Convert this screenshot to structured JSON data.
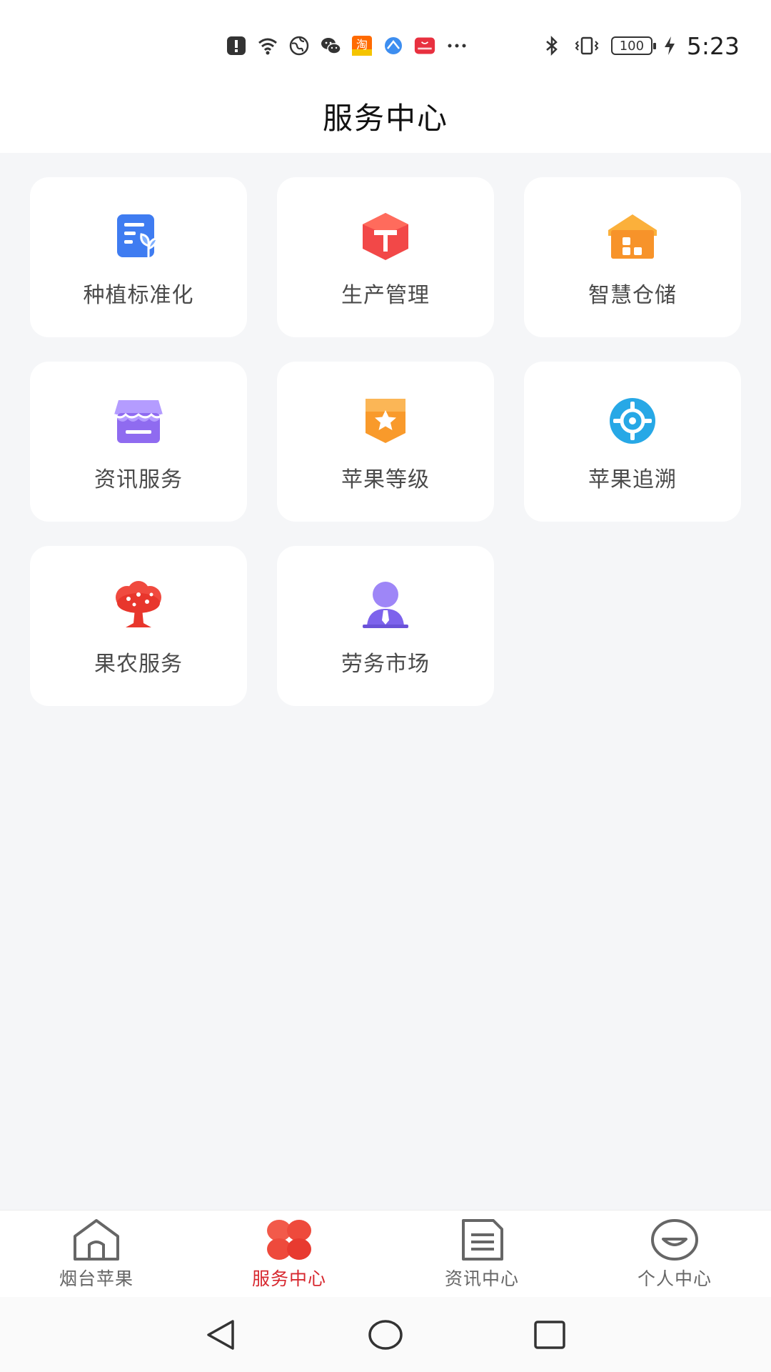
{
  "status_bar": {
    "time": "5:23",
    "battery_level": "100",
    "notification_icons": [
      "alert-icon",
      "wifi-icon",
      "vpn-globe-icon",
      "wechat-icon",
      "taobao-icon",
      "browser-icon",
      "huawei-icon",
      "more-icon"
    ],
    "system_icons": [
      "bluetooth-icon",
      "vibrate-icon",
      "battery-icon",
      "charging-icon"
    ],
    "overflow_dots": "···"
  },
  "header": {
    "title": "服务中心"
  },
  "services": [
    {
      "label": "种植标准化",
      "icon": "planting-standard-icon",
      "color": "#3f7cf1"
    },
    {
      "label": "生产管理",
      "icon": "production-box-icon",
      "color": "#f24848"
    },
    {
      "label": "智慧仓储",
      "icon": "warehouse-icon",
      "color": "#f7932a"
    },
    {
      "label": "资讯服务",
      "icon": "shop-info-icon",
      "color": "#8f6bf0"
    },
    {
      "label": "苹果等级",
      "icon": "star-badge-icon",
      "color": "#f99a2b"
    },
    {
      "label": "苹果追溯",
      "icon": "target-trace-icon",
      "color": "#27a8e6"
    },
    {
      "label": "果农服务",
      "icon": "fruit-tree-icon",
      "color": "#f04a3f"
    },
    {
      "label": "劳务市场",
      "icon": "worker-icon",
      "color": "#7d63ec"
    }
  ],
  "bottom_nav": [
    {
      "label": "烟台苹果",
      "icon": "home-icon",
      "active": false
    },
    {
      "label": "服务中心",
      "icon": "clover-icon",
      "active": true
    },
    {
      "label": "资讯中心",
      "icon": "document-icon",
      "active": false
    },
    {
      "label": "个人中心",
      "icon": "smile-icon",
      "active": false
    }
  ],
  "system_nav": [
    "back-icon",
    "home-circle-icon",
    "recents-icon"
  ],
  "colors": {
    "accent": "#d7282f",
    "background": "#f5f6f8",
    "card": "#ffffff"
  }
}
